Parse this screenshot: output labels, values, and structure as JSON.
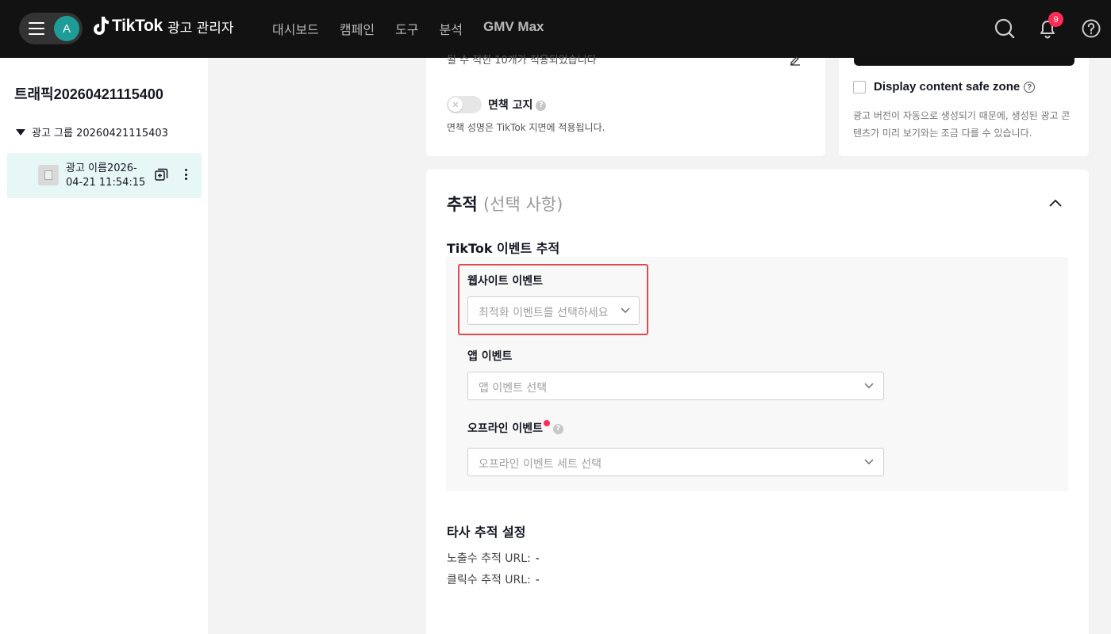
{
  "header": {
    "avatar_initial": "A",
    "logo_text": "TikTok",
    "logo_subtitle": "광고 관리자",
    "nav": [
      "대시보드",
      "캠페인",
      "도구",
      "분석",
      "GMV Max"
    ],
    "notification_count": "9"
  },
  "sidebar": {
    "campaign_name": "트래픽20260421115400",
    "ad_group_name": "광고 그룹 20260421115403",
    "ad_name": "광고 이름2026-04-21 11:54:15"
  },
  "creative": {
    "cut_text": "될 수 적힌 10개가 적용되었습니다",
    "disclaimer_label": "면책 고지",
    "disclaimer_desc": "면책 성명은 TikTok 지면에 적용됩니다."
  },
  "preview": {
    "safe_zone_label": "Display content safe zone",
    "safe_zone_desc": "광고 버전이 자동으로 생성되기 때문에, 생성된 광고 콘텐츠가 미리 보기와는 조금 다를 수 있습니다."
  },
  "tracking": {
    "title": "추적",
    "optional": "(선택 사항)",
    "tiktok_events_title": "TikTok 이벤트 추적",
    "website_events_label": "웹사이트 이벤트",
    "website_events_placeholder": "최적화 이벤트를 선택하세요",
    "app_events_label": "앱 이벤트",
    "app_events_placeholder": "앱 이벤트 선택",
    "offline_events_label": "오프라인 이벤트",
    "offline_events_placeholder": "오프라인 이벤트 세트 선택",
    "third_party_title": "타사 추적 설정",
    "impression_url_label": "노출수 추적 URL:",
    "impression_url_value": "-",
    "click_url_label": "클릭수 추적 URL:",
    "click_url_value": "-"
  },
  "colors": {
    "header_bg": "#121212",
    "accent_teal": "#1d9c98",
    "badge_red": "#fe2c55",
    "highlight_red": "#e0494f"
  }
}
